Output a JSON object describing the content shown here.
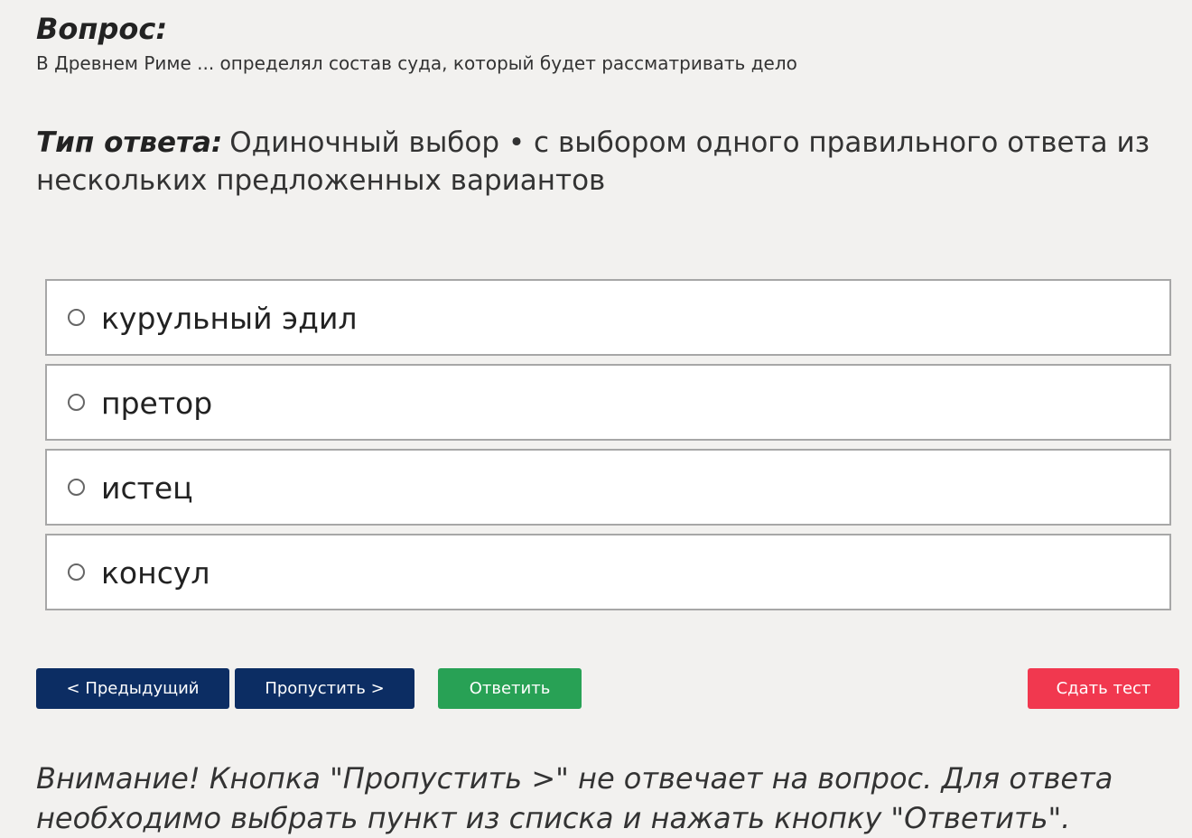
{
  "question": {
    "heading": "Вопрос:",
    "text": "В Древнем Риме ... определял состав суда, который будет рассматривать дело"
  },
  "answer_type": {
    "label": "Тип ответа:",
    "value": "Одиночный выбор • с выбором одного правильного ответа из нескольких предложенных вариантов"
  },
  "options": [
    {
      "label": "курульный эдил",
      "selected": false
    },
    {
      "label": "претор",
      "selected": false
    },
    {
      "label": "истец",
      "selected": false
    },
    {
      "label": "консул",
      "selected": false
    }
  ],
  "buttons": {
    "previous": "< Предыдущий",
    "skip": "Пропустить >",
    "answer": "Ответить",
    "submit": "Сдать тест"
  },
  "warning": "Внимание! Кнопка \"Пропустить >\" не отвечает на вопрос. Для ответа необходимо выбрать пункт из списка и нажать кнопку \"Ответить\".",
  "colors": {
    "background": "#f2f1ef",
    "nav_button": "#0c2d63",
    "answer_button": "#28a155",
    "submit_button": "#f1384f"
  },
  "icons": {
    "option_radio": "radio-unchecked-icon"
  }
}
